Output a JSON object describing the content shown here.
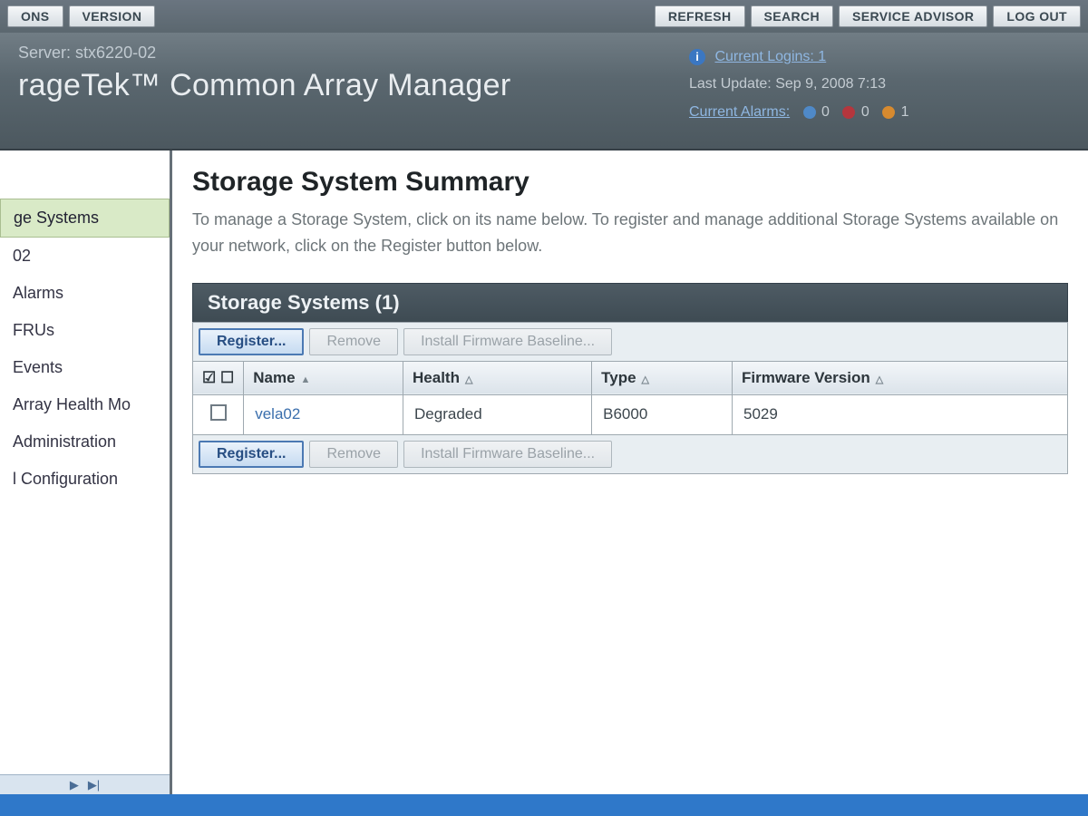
{
  "topbar": {
    "left": [
      "ONS",
      "VERSION"
    ],
    "right": [
      "REFRESH",
      "SEARCH",
      "SERVICE ADVISOR",
      "LOG OUT"
    ]
  },
  "banner": {
    "server_prefix": "Server:",
    "server_name": "stx6220-02",
    "app_title": "rageTek™ Common Array Manager",
    "logins_label": "Current Logins: 1",
    "last_update_label": "Last Update:",
    "last_update_value": "Sep 9, 2008 7:13",
    "alarms_label": "Current Alarms:",
    "alarm_counts": {
      "info": "0",
      "critical": "0",
      "warning": "1"
    }
  },
  "sidebar": {
    "items": [
      {
        "label": "ge Systems",
        "selected": true
      },
      {
        "label": "02"
      },
      {
        "label": "Alarms"
      },
      {
        "label": "FRUs"
      },
      {
        "label": "Events"
      },
      {
        "label": "Array Health Mo"
      },
      {
        "label": "Administration"
      },
      {
        "label": "l Configuration"
      }
    ]
  },
  "content": {
    "heading": "Storage System Summary",
    "description": "To manage a Storage System, click on its name below. To register and manage additional Storage Systems available on your network, click on the Register button below.",
    "panel_title": "Storage Systems (1)",
    "actions": {
      "register": "Register...",
      "remove": "Remove",
      "install_fw": "Install Firmware Baseline..."
    },
    "columns": [
      "Name",
      "Health",
      "Type",
      "Firmware Version"
    ],
    "rows": [
      {
        "name": "vela02",
        "health": "Degraded",
        "type": "B6000",
        "fw": "5029"
      }
    ]
  }
}
